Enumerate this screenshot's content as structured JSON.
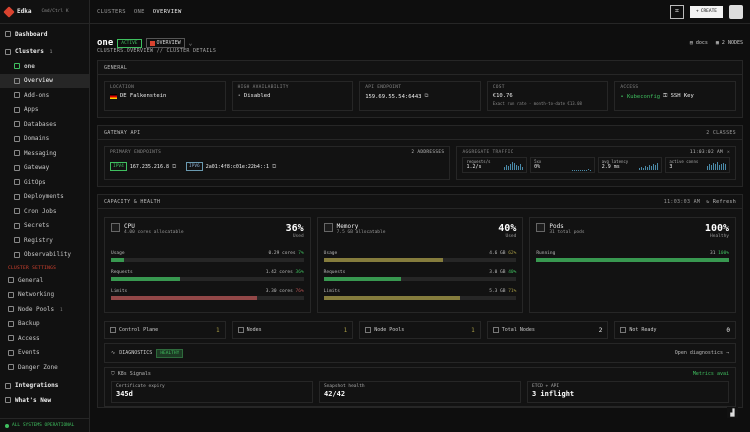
{
  "org": {
    "name": "Edka",
    "sub": "Cmd/Ctrl K"
  },
  "sidebar": {
    "dashboard": "Dashboard",
    "clusters": {
      "label": "Clusters",
      "count": "1"
    },
    "cluster_name": "one",
    "items": [
      "Overview",
      "Add-ons",
      "Apps",
      "Databases",
      "Domains",
      "Messaging",
      "Gateway",
      "GitOps",
      "Deployments",
      "Cron Jobs",
      "Secrets",
      "Registry",
      "Observability"
    ],
    "settings_title": "CLUSTER SETTINGS",
    "settings": [
      "General",
      "Networking",
      "Node Pools",
      "Backup",
      "Access",
      "Events",
      "Danger Zone"
    ],
    "node_pools_count": "1",
    "integrations": "Integrations",
    "whats_new": "What's New",
    "status": "ALL SYSTEMS OPERATIONAL"
  },
  "topbar": {
    "crumbs": [
      "CLUSTERS",
      "ONE",
      "OVERVIEW"
    ],
    "create": "CREATE"
  },
  "cluster": {
    "name": "one",
    "status": "ACTIVE",
    "view": "OVERVIEW",
    "subtitle": "CLUSTERS.OVERVIEW // CLUSTER DETAILS",
    "docs": "docs",
    "nodes": "2 NODES"
  },
  "general": {
    "title": "GENERAL",
    "location": {
      "label": "LOCATION",
      "value": "DE Falkenstein"
    },
    "ha": {
      "label": "HIGH AVAILABILITY",
      "value": "Disabled"
    },
    "api": {
      "label": "API ENDPOINT",
      "value": "159.69.55.54:6443"
    },
    "cost": {
      "label": "COST",
      "value": "€10.76",
      "note": "Exact run rate · month-to-date €13.08"
    },
    "access": {
      "label": "ACCESS",
      "kube": "Kubeconfig",
      "ssh": "SSH Key"
    }
  },
  "gateway": {
    "title": "GATEWAY API",
    "classes": "2 CLASSES",
    "primary_label": "PRIMARY ENDPOINTS",
    "addresses": "2 ADDRESSES",
    "ipv4_tag": "IPV4",
    "ipv4": "167.235.216.8",
    "ipv6_tag": "IPV6",
    "ipv6": "2a01:4f8:c01e:22b4::1",
    "traffic_label": "AGGREGATE TRAFFIC",
    "time": "11:03:02 AM",
    "metrics": [
      {
        "label": "requests/s",
        "value": "1.2/s"
      },
      {
        "label": "5xx",
        "value": "0%"
      },
      {
        "label": "avg latency",
        "value": "2.9 ms"
      },
      {
        "label": "active conns",
        "value": "3"
      }
    ]
  },
  "capacity": {
    "title": "CAPACITY & HEALTH",
    "time": "11:03:03 AM",
    "refresh": "Refresh",
    "cpu": {
      "title": "CPU",
      "sub": "4.00 cores allocatable",
      "pct": "36%",
      "pct_label": "Used",
      "rows": [
        {
          "label": "Usage",
          "value": "0.29 cores",
          "pct": "7%",
          "fill": 0.07
        },
        {
          "label": "Requests",
          "value": "1.42 cores",
          "pct": "36%",
          "fill": 0.36
        },
        {
          "label": "Limits",
          "value": "3.30 cores",
          "pct": "76%",
          "fill": 0.76
        }
      ]
    },
    "memory": {
      "title": "Memory",
      "sub": "7.5 GB allocatable",
      "pct": "40%",
      "pct_label": "Used",
      "rows": [
        {
          "label": "Usage",
          "value": "4.6 GB",
          "pct": "62%",
          "fill": 0.62
        },
        {
          "label": "Requests",
          "value": "3.0 GB",
          "pct": "40%",
          "fill": 0.4
        },
        {
          "label": "Limits",
          "value": "5.3 GB",
          "pct": "71%",
          "fill": 0.71
        }
      ]
    },
    "pods": {
      "title": "Pods",
      "sub": "31 total pods",
      "pct": "100%",
      "pct_label": "Healthy",
      "running": {
        "label": "Running",
        "value": "31",
        "pct": "100%",
        "fill": 1.0
      }
    }
  },
  "counts": [
    {
      "label": "Control Plane",
      "value": "1"
    },
    {
      "label": "Nodes",
      "value": "1"
    },
    {
      "label": "Node Pools",
      "value": "1"
    },
    {
      "label": "Total Nodes",
      "value": "2"
    },
    {
      "label": "Not Ready",
      "value": "0"
    }
  ],
  "diagnostics": {
    "label": "DIAGNOSTICS",
    "status": "HEALTHY",
    "link": "Open diagnostics"
  },
  "k8s": {
    "title": "K8s Signals",
    "metrics": "Metrics avai",
    "cells": [
      {
        "label": "Certificate expiry",
        "value": "345d"
      },
      {
        "label": "Snapshot health",
        "value": "42/42"
      },
      {
        "label": "ETCD + API",
        "value": "3 inflight"
      }
    ]
  },
  "colors": {
    "green": "#3fbf5f",
    "olive": "#a59a45",
    "red": "#b75353",
    "accent": "#d9432f"
  }
}
